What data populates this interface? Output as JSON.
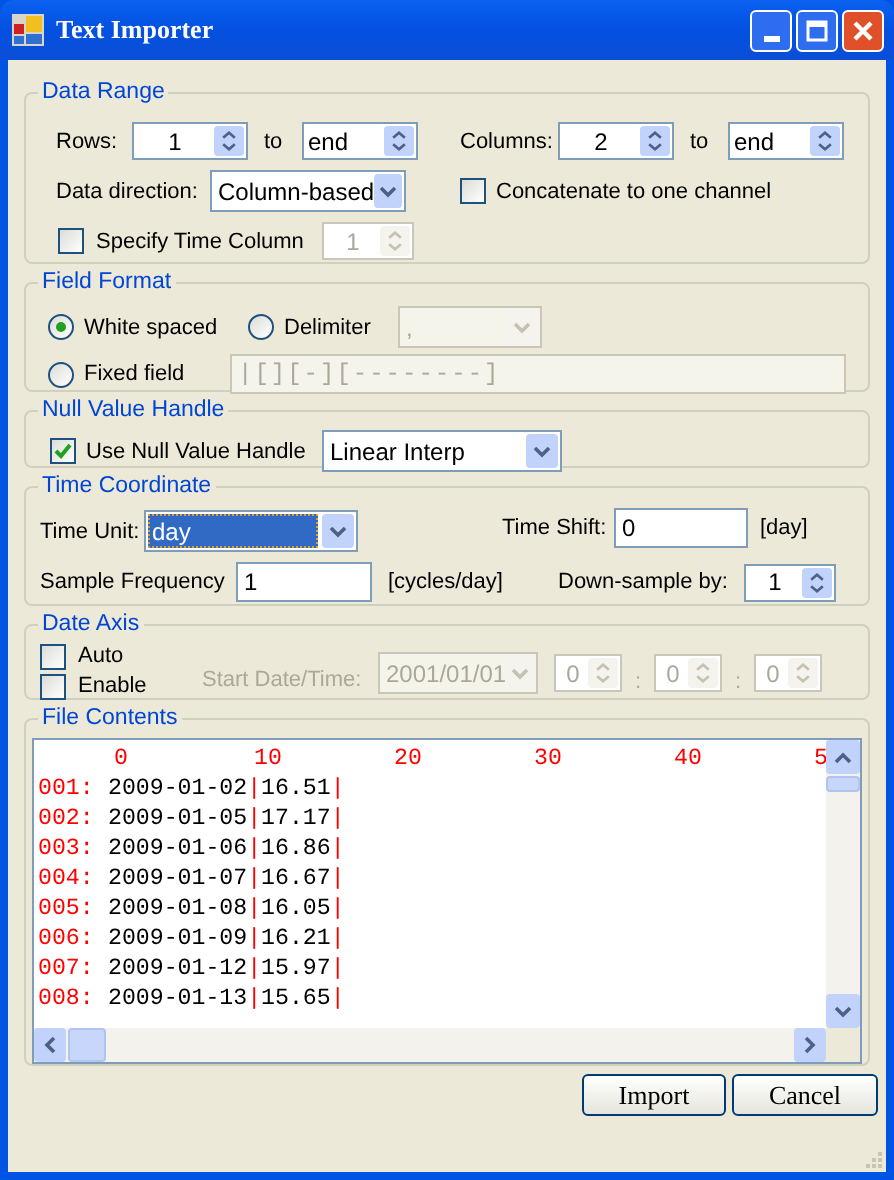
{
  "window": {
    "title": "Text Importer"
  },
  "data_range": {
    "title": "Data Range",
    "rows_label": "Rows:",
    "rows_from": {
      "value": "1",
      "disabled": false
    },
    "rows_to_label": "to",
    "rows_to": {
      "value": "end",
      "disabled": false
    },
    "columns_label": "Columns:",
    "columns_from": {
      "value": "2",
      "disabled": false
    },
    "columns_to_label": "to",
    "columns_to": {
      "value": "end",
      "disabled": false
    },
    "direction_label": "Data direction:",
    "direction": {
      "value": "Column-based",
      "disabled": false
    },
    "concatenate": {
      "label": "Concatenate to one channel",
      "checked": false
    },
    "time_column": {
      "label": "Specify Time Column",
      "checked": false
    },
    "time_column_value": {
      "value": "1",
      "disabled": true
    }
  },
  "field_format": {
    "title": "Field Format",
    "options": [
      {
        "label": "White spaced",
        "selected": true
      },
      {
        "label": "Delimiter",
        "selected": false
      },
      {
        "label": "Fixed field",
        "selected": false
      }
    ],
    "delimiter": {
      "value": ",",
      "disabled": true
    },
    "fixed_field": {
      "value": "|[][-][--------]",
      "disabled": true
    }
  },
  "null_value": {
    "title": "Null Value Handle",
    "use": {
      "label": "Use Null Value Handle",
      "checked": true
    },
    "method": {
      "value": "Linear Interp",
      "disabled": false
    }
  },
  "time_coordinate": {
    "title": "Time Coordinate",
    "unit_label": "Time Unit:",
    "unit": {
      "value": "day",
      "disabled": false,
      "focused": true
    },
    "shift_label": "Time Shift:",
    "shift": "0",
    "shift_unit": "[day]",
    "frequency_label": "Sample Frequency",
    "frequency": "1",
    "frequency_unit": "[cycles/day]",
    "downsample_label": "Down-sample by:",
    "downsample": {
      "value": "1",
      "disabled": false
    }
  },
  "date_axis": {
    "title": "Date Axis",
    "auto": {
      "label": "Auto",
      "checked": false
    },
    "enable": {
      "label": "Enable",
      "checked": false
    },
    "start_label": "Start Date/Time:",
    "start_disabled": true,
    "start_date": {
      "value": "2001/01/01",
      "disabled": true
    },
    "time_parts": [
      {
        "value": "0",
        "disabled": true
      },
      {
        "value": "0",
        "disabled": true
      },
      {
        "value": "0",
        "disabled": true
      }
    ],
    "separators": [
      ":",
      ":"
    ]
  },
  "file_contents": {
    "title": "File Contents",
    "ruler": [
      "0",
      "10",
      "20",
      "30",
      "40",
      "5"
    ],
    "lines": [
      {
        "number": "001:",
        "text": "2009-01-02|16.51|"
      },
      {
        "number": "002:",
        "text": "2009-01-05|17.17|"
      },
      {
        "number": "003:",
        "text": "2009-01-06|16.86|"
      },
      {
        "number": "004:",
        "text": "2009-01-07|16.67|"
      },
      {
        "number": "005:",
        "text": "2009-01-08|16.05|"
      },
      {
        "number": "006:",
        "text": "2009-01-09|16.21|"
      },
      {
        "number": "007:",
        "text": "2009-01-12|15.97|"
      },
      {
        "number": "008:",
        "text": "2009-01-13|15.65|"
      }
    ]
  },
  "buttons": [
    "Import",
    "Cancel"
  ]
}
